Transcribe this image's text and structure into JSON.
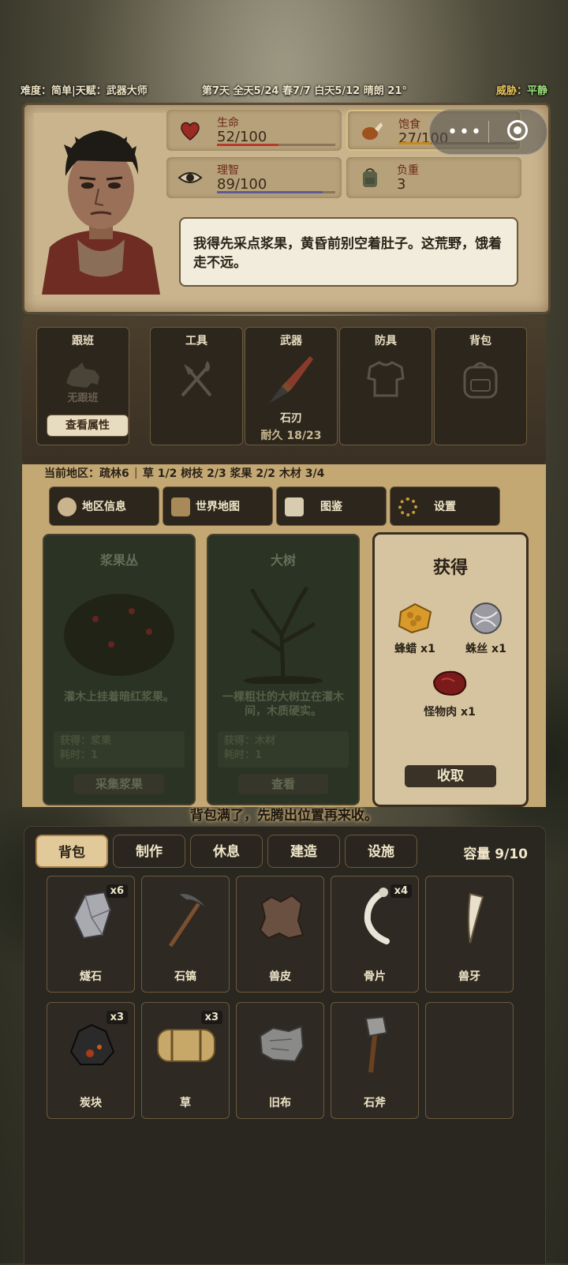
{
  "status_bar": {
    "left": "难度：简单|天赋：武器大师",
    "middle": "第7天  全天5/24  春7/7  白天5/12  晴朗  21°",
    "threat_label": "威胁：",
    "threat_value": "平静"
  },
  "character": {
    "stats": [
      {
        "name": "生命",
        "value": "52/100",
        "icon": "heart-icon",
        "fill": 0.52,
        "color": "#b83a2a"
      },
      {
        "name": "饱食",
        "value": "27/100",
        "icon": "meat-drumstick-icon",
        "fill": 0.27,
        "color": "#c8881a"
      },
      {
        "name": "理智",
        "value": "89/100",
        "icon": "eye-icon",
        "fill": 0.89,
        "color": "#5a5a9a"
      },
      {
        "name": "负重",
        "value": "3",
        "icon": "backpack-icon"
      }
    ],
    "speech": "我得先采点浆果，黄昏前别空着肚子。这荒野，饿着走不远。"
  },
  "equipment": {
    "companion": {
      "title": "跟班",
      "empty_text": "无跟班",
      "button": "查看属性"
    },
    "tool": {
      "title": "工具"
    },
    "weapon": {
      "title": "武器",
      "item": "石刃",
      "durability": "耐久 18/23"
    },
    "armor": {
      "title": "防具"
    },
    "bag": {
      "title": "背包"
    }
  },
  "area": {
    "current": "当前地区：疏林6",
    "resources": "草 1/2 树枝 2/3 浆果 2/2 木材 3/4"
  },
  "nav": [
    {
      "label": "地区信息",
      "icon": "region-info-icon"
    },
    {
      "label": "世界地图",
      "icon": "world-map-icon"
    },
    {
      "label": "图鉴",
      "icon": "codex-icon"
    },
    {
      "label": "设置",
      "icon": "gear-icon"
    }
  ],
  "actions": [
    {
      "title": "浆果丛",
      "desc": "灌木上挂着暗红浆果。",
      "gain": "获得：浆果",
      "time": "耗时：1",
      "button": "采集浆果"
    },
    {
      "title": "大树",
      "desc": "一棵粗壮的大树立在灌木间，木质硬实。",
      "gain": "获得：木材",
      "time": "耗时：1",
      "button": "查看"
    }
  ],
  "obtained": {
    "title": "获得",
    "items": [
      {
        "label": "蜂蜡 x1",
        "icon": "beeswax-icon"
      },
      {
        "label": "蛛丝 x1",
        "icon": "spider-silk-icon"
      },
      {
        "label": "怪物肉 x1",
        "icon": "monster-meat-icon"
      }
    ],
    "button": "收取"
  },
  "warning": "背包满了，先腾出位置再来收。",
  "inventory": {
    "tabs": [
      "背包",
      "制作",
      "休息",
      "建造",
      "设施"
    ],
    "capacity": "容量 9/10",
    "items": [
      {
        "name": "燧石",
        "qty": "x6",
        "icon": "flint-icon"
      },
      {
        "name": "石镐",
        "qty": "",
        "icon": "pickaxe-icon"
      },
      {
        "name": "兽皮",
        "qty": "",
        "icon": "hide-icon"
      },
      {
        "name": "骨片",
        "qty": "x4",
        "icon": "bone-icon"
      },
      {
        "name": "兽牙",
        "qty": "",
        "icon": "fang-icon"
      },
      {
        "name": "炭块",
        "qty": "x3",
        "icon": "charcoal-icon"
      },
      {
        "name": "草",
        "qty": "x3",
        "icon": "grass-bundle-icon"
      },
      {
        "name": "旧布",
        "qty": "",
        "icon": "old-cloth-icon"
      },
      {
        "name": "石斧",
        "qty": "",
        "icon": "stone-axe-icon"
      }
    ]
  }
}
